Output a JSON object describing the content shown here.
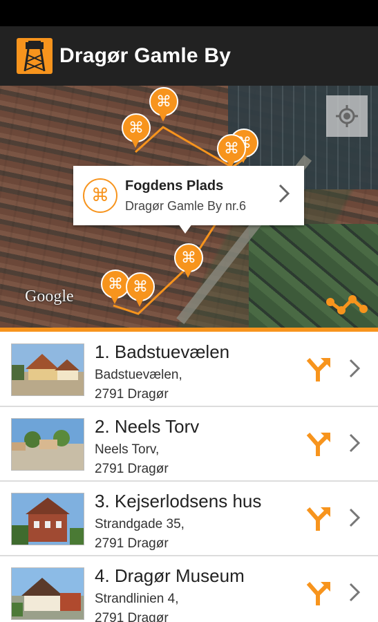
{
  "app": {
    "title": "Dragør Gamle By",
    "accent_color": "#f7941d",
    "icon": "watchtower-icon"
  },
  "map": {
    "attribution": "Google",
    "callout": {
      "title": "Fogdens Plads",
      "subtitle": "Dragør Gamle By nr.6",
      "icon": "command-icon"
    },
    "marker_glyph": "⌘",
    "buttons": {
      "locate": "my-location-icon",
      "route": "route-icon"
    }
  },
  "list": {
    "items": [
      {
        "title": "1. Badstuevælen",
        "address1": "Badstuevælen,",
        "address2": "2791 Dragør"
      },
      {
        "title": "2. Neels Torv",
        "address1": "Neels Torv,",
        "address2": "2791 Dragør"
      },
      {
        "title": "3. Kejserlodsens hus",
        "address1": "Strandgade 35,",
        "address2": "2791 Dragør"
      },
      {
        "title": "4. Dragør Museum",
        "address1": "Strandlinien 4,",
        "address2": "2791 Dragør"
      }
    ]
  }
}
